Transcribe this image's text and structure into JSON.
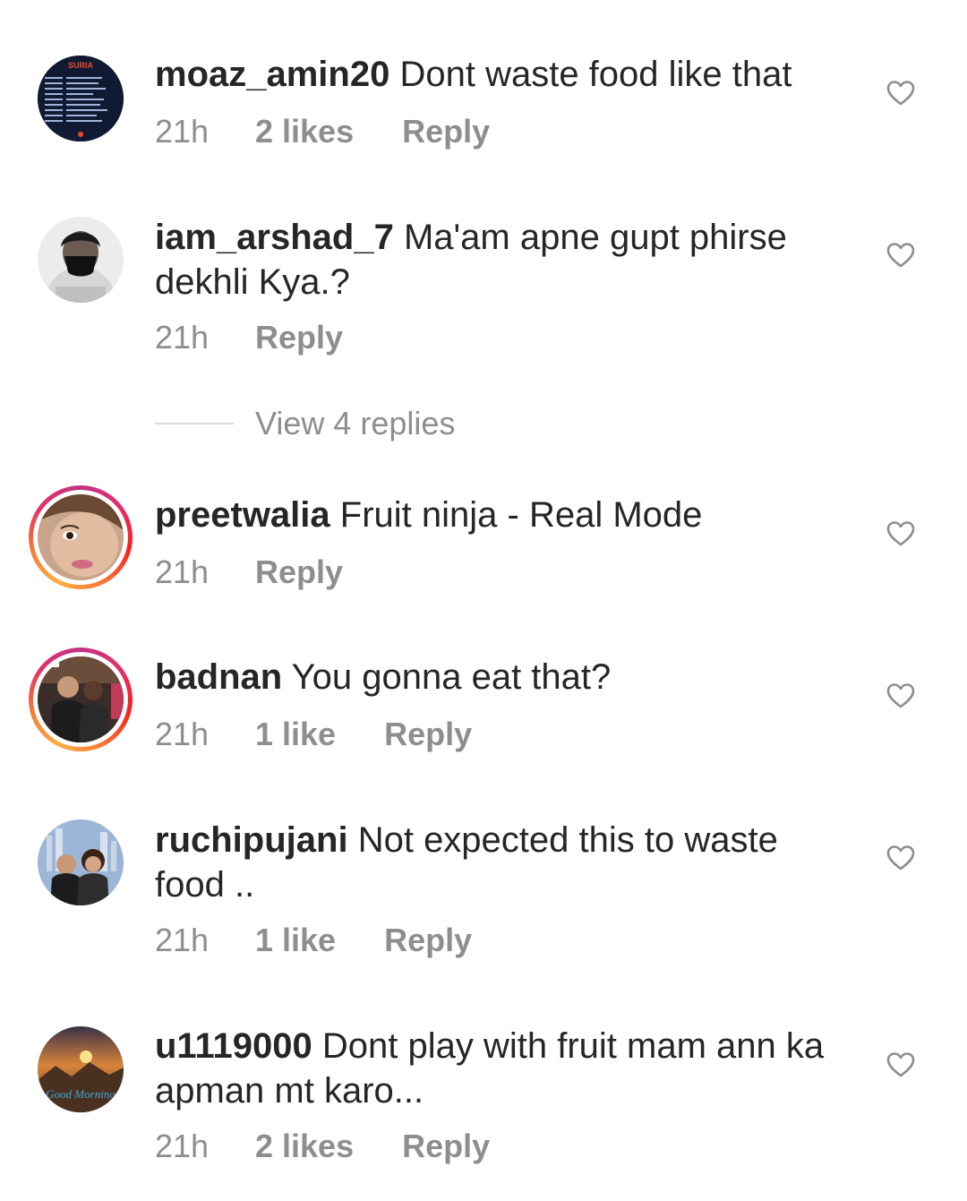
{
  "comments": [
    {
      "username": "moaz_amin20",
      "text": "Dont waste food like that",
      "time": "21h",
      "likes": "2 likes",
      "reply": "Reply",
      "avatar_text": "SURIA"
    },
    {
      "username": "iam_arshad_7",
      "text": "Ma'am apne gupt phirse dekhli Kya.?",
      "time": "21h",
      "likes": null,
      "reply": "Reply"
    },
    {
      "username": "preetwalia",
      "text": "Fruit ninja - Real Mode",
      "time": "21h",
      "likes": null,
      "reply": "Reply"
    },
    {
      "username": "badnan",
      "text": "You gonna eat that?",
      "time": "21h",
      "likes": "1 like",
      "reply": "Reply"
    },
    {
      "username": "ruchipujani",
      "text": "Not expected this to waste food ..",
      "time": "21h",
      "likes": "1 like",
      "reply": "Reply"
    },
    {
      "username": "u1119000",
      "text": "Dont play with fruit mam ann ka apman mt karo...",
      "time": "21h",
      "likes": "2 likes",
      "reply": "Reply",
      "avatar_text": "Good Morning"
    }
  ],
  "view_replies": "View 4 replies",
  "icons": {
    "like": "heart-outline-icon"
  },
  "colors": {
    "text": "#262626",
    "secondary": "#8e8e8e",
    "story_ring": "#e1306c"
  }
}
